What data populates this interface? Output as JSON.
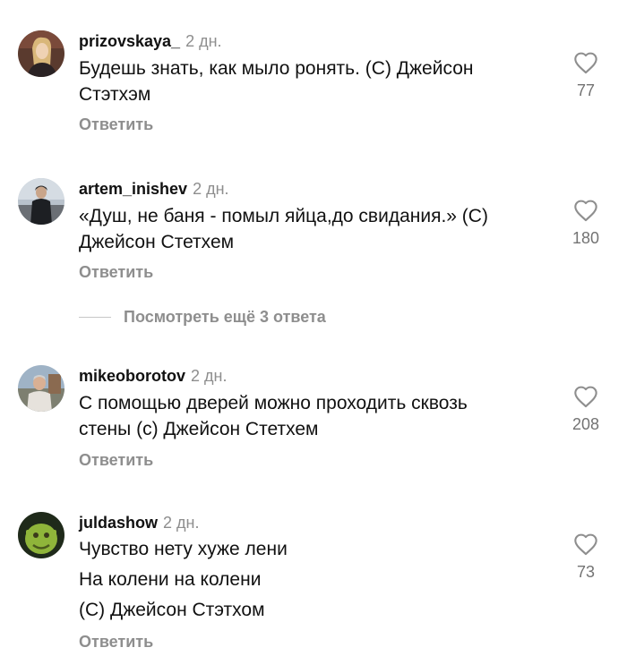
{
  "comments": [
    {
      "username": "prizovskaya_",
      "time": "2 дн.",
      "lines": [
        "Будешь знать, как мыло ронять. (С) Джейсон",
        "Стэтхэм"
      ],
      "likes": "77",
      "reply_label": "Ответить",
      "avatar": "avatar-photo-woman"
    },
    {
      "username": "artem_inishev",
      "time": "2 дн.",
      "lines": [
        "«Душ, не баня - помыл яйца,до свидания.» (С)",
        "Джейсон Стетхем"
      ],
      "likes": "180",
      "reply_label": "Ответить",
      "avatar": "avatar-photo-man"
    },
    {
      "username": "mikeoborotov",
      "time": "2 дн.",
      "lines": [
        "С помощью дверей можно проходить сквозь",
        "стены (с) Джейсон Стетхем"
      ],
      "likes": "208",
      "reply_label": "Ответить",
      "avatar": "avatar-photo-man-outdoor"
    },
    {
      "username": "juldashow",
      "time": "2 дн.",
      "lines": [
        "Чувство нету хуже лени",
        "На колени на колени",
        "(С) Джейсон Стэтхом"
      ],
      "likes": "73",
      "reply_label": "Ответить",
      "avatar": "avatar-shrek"
    }
  ],
  "more_replies_label": "Посмотреть ещё 3 ответа",
  "icons": {
    "like": "heart-outline-icon"
  },
  "colors": {
    "text": "#111111",
    "secondary": "#8e8e8e",
    "like_count": "#737373",
    "divider": "#c7c7c7"
  }
}
